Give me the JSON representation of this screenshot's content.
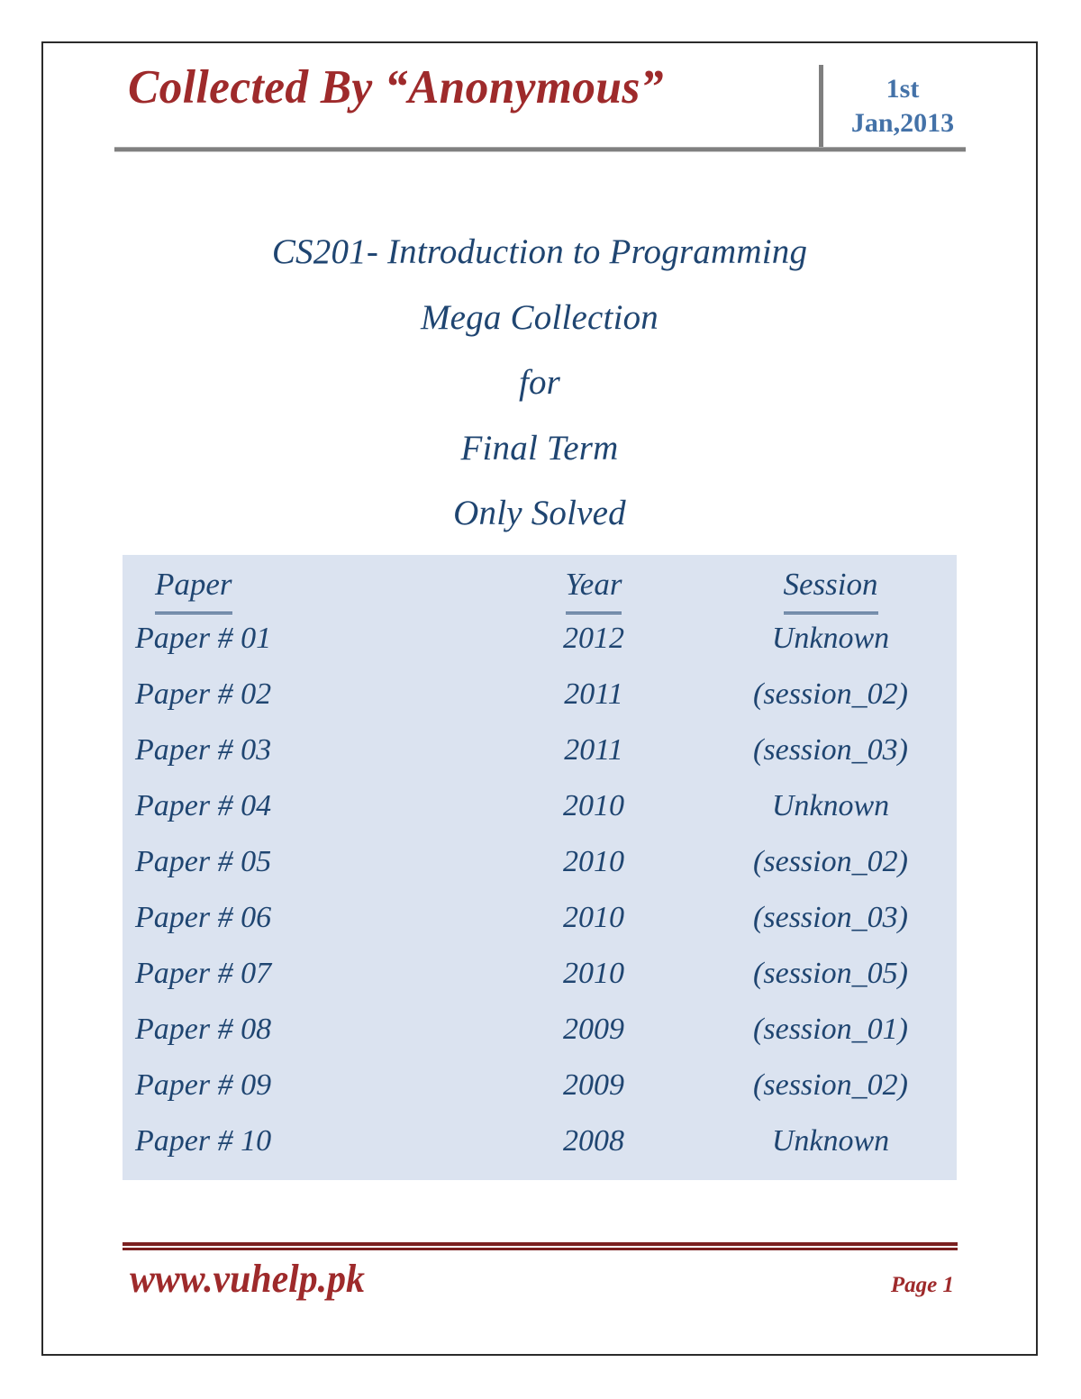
{
  "page": {
    "background_color": "#ffffff",
    "border_color": "#2b2b2b"
  },
  "header": {
    "title": "Collected By “Anonymous”",
    "title_color": "#9e2a2b",
    "date_line1": "1st",
    "date_line2": "Jan,2013",
    "date_color": "#4472a8",
    "rule_color": "#808080",
    "divider_color": "#7f7f7f"
  },
  "doc_title": {
    "color": "#1f4571",
    "lines": [
      "CS201- Introduction to Programming",
      "Mega Collection",
      "for",
      "Final Term",
      "Only Solved"
    ]
  },
  "table": {
    "background_color": "#dbe3f0",
    "text_color": "#1f4571",
    "columns": [
      "Paper ",
      "Year",
      "Session"
    ],
    "rows": [
      {
        "paper": "Paper # 01",
        "year": "2012",
        "session": "Unknown"
      },
      {
        "paper": "Paper # 02",
        "year": "2011",
        "session": "(session_02)"
      },
      {
        "paper": "Paper # 03",
        "year": "2011",
        "session": "(session_03)"
      },
      {
        "paper": "Paper # 04",
        "year": "2010",
        "session": "Unknown"
      },
      {
        "paper": "Paper # 05",
        "year": "2010",
        "session": "(session_02)"
      },
      {
        "paper": "Paper # 06",
        "year": "2010",
        "session": "(session_03)"
      },
      {
        "paper": "Paper # 07",
        "year": "2010",
        "session": "(session_05)"
      },
      {
        "paper": "Paper # 08",
        "year": "2009",
        "session": "(session_01)"
      },
      {
        "paper": "Paper # 09",
        "year": "2009",
        "session": "(session_02)"
      },
      {
        "paper": "Paper # 10",
        "year": "2008",
        "session": "Unknown"
      }
    ]
  },
  "footer": {
    "site": "www.vuhelp.pk",
    "page_label": "Page 1",
    "color": "#9e2a2b",
    "rule_color": "#7b2020"
  }
}
